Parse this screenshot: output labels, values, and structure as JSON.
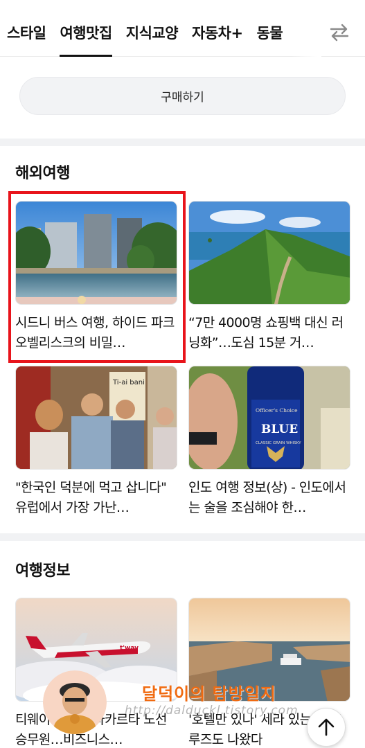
{
  "tabs": [
    {
      "label": "스타일",
      "active": false
    },
    {
      "label": "여행맛집",
      "active": true
    },
    {
      "label": "지식교양",
      "active": false
    },
    {
      "label": "자동차+",
      "active": false
    },
    {
      "label": "동물",
      "active": false
    }
  ],
  "purchase_button": {
    "label": "구매하기"
  },
  "sections": [
    {
      "title": "해외여행",
      "cards": [
        {
          "title": "시드니 버스 여행, 하이드 파크 오벨리스크의 비밀…",
          "highlighted": true
        },
        {
          "title": "“7만 4000명 쇼핑백 대신 러닝화”…도심 15분 거…"
        },
        {
          "title": "\"한국인 덕분에 먹고 삽니다\" 유럽에서 가장 가난…"
        },
        {
          "title": "인도 여행 정보(상) - 인도에서는 술을 조심해야 한…"
        }
      ]
    },
    {
      "title": "여행정보",
      "cards": [
        {
          "title": "티웨이항공 월 자카르타 노선 승무원…비즈니스…"
        },
        {
          "title": "'호텔만 있나' 세라 있는 급 크루즈도 나왔다"
        }
      ]
    }
  ],
  "thumb_texts": {
    "bottle_brand": "Officer's Choice",
    "bottle_label": "BLUE",
    "bottle_sub": "CLASSIC GRAIN WHISKY",
    "plane_livery": "t'way",
    "sign_text": "Ti-ai bani"
  },
  "watermark": {
    "text": "달덕이의 탐방일지",
    "url": "http://dalduckl.tistory.com"
  },
  "icons": {
    "swap": "swap-arrows-icon",
    "scroll_top": "arrow-up-icon"
  },
  "colors": {
    "highlight": "#e8141b",
    "watermark": "#f06a10",
    "separator": "#f1f2f4"
  }
}
